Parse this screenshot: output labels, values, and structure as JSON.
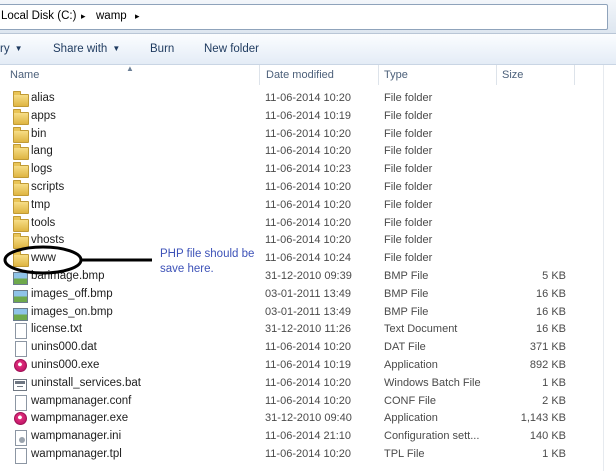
{
  "address_bar": {
    "segments": [
      "Local Disk (C:)",
      "▸",
      "wamp",
      "▸"
    ]
  },
  "toolbar": {
    "organize_label": "ry",
    "share_label": "Share with",
    "burn_label": "Burn",
    "new_folder_label": "New folder"
  },
  "columns": {
    "name": "Name",
    "date": "Date modified",
    "type": "Type",
    "size": "Size"
  },
  "files": [
    {
      "name": "alias",
      "date": "11-06-2014 10:20",
      "type": "File folder",
      "size": "",
      "icon": "folder-icon"
    },
    {
      "name": "apps",
      "date": "11-06-2014 10:19",
      "type": "File folder",
      "size": "",
      "icon": "folder-icon"
    },
    {
      "name": "bin",
      "date": "11-06-2014 10:20",
      "type": "File folder",
      "size": "",
      "icon": "folder-icon"
    },
    {
      "name": "lang",
      "date": "11-06-2014 10:20",
      "type": "File folder",
      "size": "",
      "icon": "folder-icon"
    },
    {
      "name": "logs",
      "date": "11-06-2014 10:23",
      "type": "File folder",
      "size": "",
      "icon": "folder-icon"
    },
    {
      "name": "scripts",
      "date": "11-06-2014 10:20",
      "type": "File folder",
      "size": "",
      "icon": "folder-icon"
    },
    {
      "name": "tmp",
      "date": "11-06-2014 10:20",
      "type": "File folder",
      "size": "",
      "icon": "folder-icon"
    },
    {
      "name": "tools",
      "date": "11-06-2014 10:20",
      "type": "File folder",
      "size": "",
      "icon": "folder-icon"
    },
    {
      "name": "vhosts",
      "date": "11-06-2014 10:20",
      "type": "File folder",
      "size": "",
      "icon": "folder-icon"
    },
    {
      "name": "www",
      "date": "11-06-2014 10:24",
      "type": "File folder",
      "size": "",
      "icon": "folder-icon"
    },
    {
      "name": "barimage.bmp",
      "date": "31-12-2010 09:39",
      "type": "BMP File",
      "size": "5 KB",
      "icon": "bmp-icon"
    },
    {
      "name": "images_off.bmp",
      "date": "03-01-2011 13:49",
      "type": "BMP File",
      "size": "16 KB",
      "icon": "bmp-icon"
    },
    {
      "name": "images_on.bmp",
      "date": "03-01-2011 13:49",
      "type": "BMP File",
      "size": "16 KB",
      "icon": "bmp-icon"
    },
    {
      "name": "license.txt",
      "date": "31-12-2010 11:26",
      "type": "Text Document",
      "size": "16 KB",
      "icon": "text-document-icon"
    },
    {
      "name": "unins000.dat",
      "date": "11-06-2014 10:20",
      "type": "DAT File",
      "size": "371 KB",
      "icon": "document-icon"
    },
    {
      "name": "unins000.exe",
      "date": "11-06-2014 10:19",
      "type": "Application",
      "size": "892 KB",
      "icon": "application-icon"
    },
    {
      "name": "uninstall_services.bat",
      "date": "11-06-2014 10:20",
      "type": "Windows Batch File",
      "size": "1 KB",
      "icon": "batch-file-icon"
    },
    {
      "name": "wampmanager.conf",
      "date": "11-06-2014 10:20",
      "type": "CONF File",
      "size": "2 KB",
      "icon": "document-icon"
    },
    {
      "name": "wampmanager.exe",
      "date": "31-12-2010 09:40",
      "type": "Application",
      "size": "1,143 KB",
      "icon": "application-icon"
    },
    {
      "name": "wampmanager.ini",
      "date": "11-06-2014 21:10",
      "type": "Configuration sett...",
      "size": "140 KB",
      "icon": "settings-file-icon"
    },
    {
      "name": "wampmanager.tpl",
      "date": "11-06-2014 10:20",
      "type": "TPL File",
      "size": "1 KB",
      "icon": "document-icon"
    }
  ],
  "annotation": {
    "text": "PHP file should be save here.",
    "color": "#3d52b8"
  }
}
